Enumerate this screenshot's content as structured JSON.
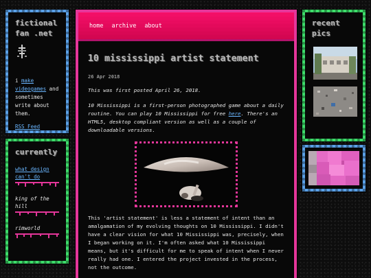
{
  "site": {
    "title_line1": "fictional",
    "title_line2": "fan .net",
    "bio_before": "i ",
    "bio_link": "make videogames",
    "bio_after": " and sometimes write about them.",
    "rss_label": "RSS Feed"
  },
  "currently": {
    "title": "currently",
    "items": [
      {
        "label": "what design can't do"
      },
      {
        "label": "king of the hill"
      },
      {
        "label": "rimworld"
      }
    ]
  },
  "nav": {
    "home": "home",
    "archive": "archive",
    "about": "about"
  },
  "post": {
    "title": "10 mississippi artist statement",
    "date": "26 Apr 2018",
    "first_posted": "This was first posted April 26, 2018.",
    "intro_before": "10 Mississippi is a first-person photographed game about a daily routine. You can play 10 Mississippi for free ",
    "intro_link": "here",
    "intro_after": ". There's an HTML5, desktop compliant version as well as a couple of downloadable versions.",
    "body": "This 'artist statement' is less a statement of intent than an amalgamation of my evolving thoughts on 10 Mississippi. I didn't have a clear vision for what 10 Mississippi was, precisely, when I began working on it. I'm often asked what 10 Mississippi means, but it's difficult for me to speak of intent when I never really had one. I entered the project invested in the process, not the outcome."
  },
  "pics": {
    "title_line1": "recent",
    "title_line2": "pics"
  },
  "colors": {
    "pink": "#e5369a",
    "blue": "#5aa0e6",
    "green": "#3ddc6a",
    "link": "#6ab6ff"
  }
}
